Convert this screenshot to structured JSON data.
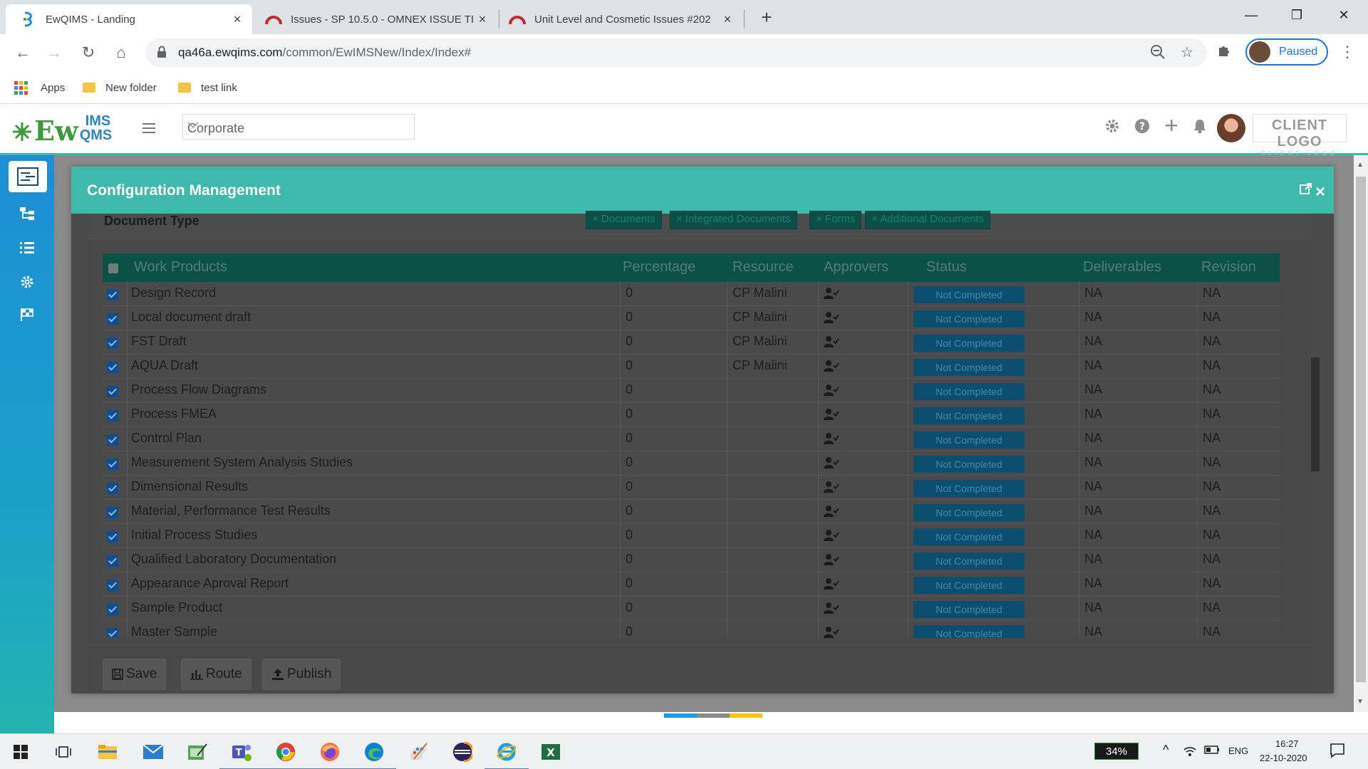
{
  "browser": {
    "tabs": [
      {
        "title": "EwQIMS - Landing",
        "close": "×"
      },
      {
        "title": "Issues - SP 10.5.0 - OMNEX ISSUE TI",
        "close": "×"
      },
      {
        "title": "Unit Level and Cosmetic Issues #202",
        "close": "×"
      }
    ],
    "new_tab": "+",
    "window_controls": {
      "minimize": "—",
      "restore": "❐",
      "close": "✕"
    },
    "url_host": "qa46a.ewqims.com",
    "url_path": "/common/EwIMSNew/Index/Index#",
    "profile_status": "Paused",
    "bookmarks": [
      {
        "label": "Apps"
      },
      {
        "label": "New folder"
      },
      {
        "label": "test link"
      }
    ]
  },
  "app": {
    "logo_main": "Ew",
    "logo_top": "IMS",
    "logo_bottom": "QMS",
    "site_selector": "Corporate",
    "client_logo": "CLIENT LOGO",
    "client_logo_sub": "CLIENT LOGO",
    "header_icons": [
      "gear-icon",
      "help-icon",
      "plus-icon",
      "bell-icon"
    ],
    "nav_icons": [
      "dashboard-icon",
      "hierarchy-icon",
      "checklist-icon",
      "settings-icon",
      "flag-icon"
    ]
  },
  "modal": {
    "title": "Configuration Management",
    "doc_type_label": "Document Type",
    "doc_chips": [
      "× Documents",
      "× Integrated Documents",
      "× Forms",
      "× Additional Documents"
    ],
    "columns": [
      "Work Products",
      "Percentage",
      "Resource",
      "Approvers",
      "Status",
      "Deliverables",
      "Revision"
    ],
    "rows": [
      {
        "name": "Design Record",
        "pct": "0",
        "resource": "CP Malini",
        "status": "Not Completed",
        "deliv": "NA",
        "rev": "NA"
      },
      {
        "name": "Local document draft",
        "pct": "0",
        "resource": "CP Malini",
        "status": "Not Completed",
        "deliv": "NA",
        "rev": "NA"
      },
      {
        "name": "FST Draft",
        "pct": "0",
        "resource": "CP Malini",
        "status": "Not Completed",
        "deliv": "NA",
        "rev": "NA"
      },
      {
        "name": "AQUA Draft",
        "pct": "0",
        "resource": "CP Malini",
        "status": "Not Completed",
        "deliv": "NA",
        "rev": "NA"
      },
      {
        "name": "Process Flow Diagrams",
        "pct": "0",
        "resource": "",
        "status": "Not Completed",
        "deliv": "NA",
        "rev": "NA"
      },
      {
        "name": "Process FMEA",
        "pct": "0",
        "resource": "",
        "status": "Not Completed",
        "deliv": "NA",
        "rev": "NA"
      },
      {
        "name": "Control Plan",
        "pct": "0",
        "resource": "",
        "status": "Not Completed",
        "deliv": "NA",
        "rev": "NA"
      },
      {
        "name": "Measurement System Analysis Studies",
        "pct": "0",
        "resource": "",
        "status": "Not Completed",
        "deliv": "NA",
        "rev": "NA"
      },
      {
        "name": "Dimensional Results",
        "pct": "0",
        "resource": "",
        "status": "Not Completed",
        "deliv": "NA",
        "rev": "NA"
      },
      {
        "name": "Material, Performance Test Results",
        "pct": "0",
        "resource": "",
        "status": "Not Completed",
        "deliv": "NA",
        "rev": "NA"
      },
      {
        "name": "Initial Process Studies",
        "pct": "0",
        "resource": "",
        "status": "Not Completed",
        "deliv": "NA",
        "rev": "NA"
      },
      {
        "name": "Qualified Laboratory Documentation",
        "pct": "0",
        "resource": "",
        "status": "Not Completed",
        "deliv": "NA",
        "rev": "NA"
      },
      {
        "name": "Appearance Aproval Report",
        "pct": "0",
        "resource": "",
        "status": "Not Completed",
        "deliv": "NA",
        "rev": "NA"
      },
      {
        "name": "Sample Product",
        "pct": "0",
        "resource": "",
        "status": "Not Completed",
        "deliv": "NA",
        "rev": "NA"
      },
      {
        "name": "Master Sample",
        "pct": "0",
        "resource": "",
        "status": "Not Completed",
        "deliv": "NA",
        "rev": "NA"
      }
    ],
    "buttons": {
      "save": "Save",
      "route": "Route",
      "publish": "Publish"
    }
  },
  "taskbar": {
    "battery": "34%",
    "language": "ENG",
    "time": "16:27",
    "date": "22-10-2020"
  },
  "colors": {
    "teal": "#3fb9ab",
    "nav_blue": "#1d8fd6",
    "chrome_blue": "#1a73e8"
  }
}
